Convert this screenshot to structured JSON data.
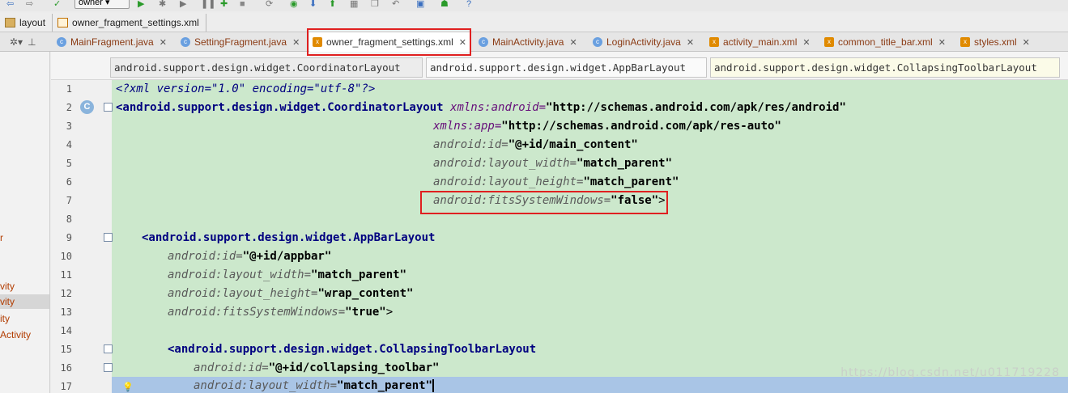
{
  "toolbar": {
    "config_label": "owner"
  },
  "breadcrumb": [
    {
      "label": "layout",
      "icon": "folder-icon"
    },
    {
      "label": "owner_fragment_settings.xml",
      "icon": "xml-file-icon"
    }
  ],
  "tabs": [
    {
      "label": "MainFragment.java",
      "icon": "class-icon",
      "color": "#6aa0e0"
    },
    {
      "label": "SettingFragment.java",
      "icon": "class-icon",
      "color": "#6aa0e0"
    },
    {
      "label": "owner_fragment_settings.xml",
      "icon": "xml-file-icon",
      "color": "#e08a00",
      "active": true
    },
    {
      "label": "MainActivity.java",
      "icon": "class-icon",
      "color": "#6aa0e0"
    },
    {
      "label": "LoginActivity.java",
      "icon": "class-icon",
      "color": "#6aa0e0"
    },
    {
      "label": "activity_main.xml",
      "icon": "xml-file-icon",
      "color": "#e08a00"
    },
    {
      "label": "common_title_bar.xml",
      "icon": "xml-file-icon",
      "color": "#e08a00"
    },
    {
      "label": "styles.xml",
      "icon": "xml-file-icon",
      "color": "#e08a00"
    }
  ],
  "left_panel": [
    "r",
    "vity",
    "vity",
    "ity",
    "Activity"
  ],
  "tag_crumbs": [
    "android.support.design.widget.CoordinatorLayout",
    "android.support.design.widget.AppBarLayout",
    "android.support.design.widget.CollapsingToolbarLayout"
  ],
  "line_numbers": [
    "1",
    "2",
    "3",
    "4",
    "5",
    "6",
    "7",
    "8",
    "9",
    "10",
    "11",
    "12",
    "13",
    "14",
    "15",
    "16",
    "17"
  ],
  "code": {
    "l1": "<?xml version=\"1.0\" encoding=\"utf-8\"?>",
    "l2a": "<android.support.design.widget.CoordinatorLayout ",
    "l2b": "xmlns:android=",
    "l2c": "\"http://schemas.android.com/apk/res/android\"",
    "l3a": "xmlns:app=",
    "l3b": "\"http://schemas.android.com/apk/res-auto\"",
    "l4a": "android:id=",
    "l4b": "\"@+id/main_content\"",
    "l5a": "android:layout_width=",
    "l5b": "\"match_parent\"",
    "l6a": "android:layout_height=",
    "l6b": "\"match_parent\"",
    "l7a": "android:fitsSystemWindows=",
    "l7b": "\"false\"",
    "l7c": ">",
    "l9": "<android.support.design.widget.AppBarLayout",
    "l10a": "android:id=",
    "l10b": "\"@+id/appbar\"",
    "l11a": "android:layout_width=",
    "l11b": "\"match_parent\"",
    "l12a": "android:layout_height=",
    "l12b": "\"wrap_content\"",
    "l13a": "android:fitsSystemWindows=",
    "l13b": "\"true\"",
    "l13c": ">",
    "l15": "<android.support.design.widget.CollapsingToolbarLayout",
    "l16a": "android:id=",
    "l16b": "\"@+id/collapsing_toolbar\"",
    "l17a": "android:layout_width=",
    "l17b": "\"match_parent\""
  },
  "gutter_marker": "C",
  "watermark": "https://blog.csdn.net/u011719228",
  "colors": {
    "editor_bg": "#cce8cc",
    "highlight": "#e02020",
    "current_line": "#a9c5e6"
  }
}
